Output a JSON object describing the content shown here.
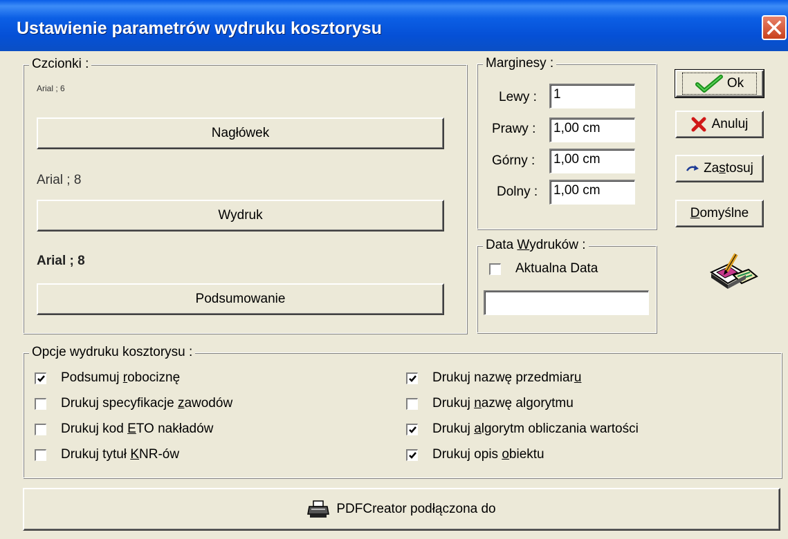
{
  "window": {
    "title": "Ustawienie parametrów wydruku kosztorysu"
  },
  "fonts": {
    "label": "Czcionki :",
    "naglowek_font": "Arial ; 6",
    "naglowek_button": "Nagłówek",
    "wydruk_font": "Arial ; 8",
    "wydruk_button": "Wydruk",
    "podsumowanie_font": "Arial ; 8",
    "podsumowanie_button": "Podsumowanie"
  },
  "margins": {
    "label": "Marginesy :",
    "lewy_label": "Lewy :",
    "lewy_value": "1",
    "prawy_label": "Prawy :",
    "prawy_value": "1,00 cm",
    "gorny_label": "Górny :",
    "gorny_value": "1,00 cm",
    "dolny_label": "Dolny :",
    "dolny_value": "1,00 cm"
  },
  "date": {
    "label_pre": "Data ",
    "label_u": "W",
    "label_post": "ydruków :",
    "current_label": "Aktualna Data",
    "current_checked": false,
    "value": ""
  },
  "actions": {
    "ok": "Ok",
    "cancel": "Anuluj",
    "apply_pre": "Za",
    "apply_u": "s",
    "apply_post": "tosuj",
    "defaults_u": "D",
    "defaults_post": "omyślne"
  },
  "options": {
    "label": "Opcje wydruku kosztorysu :",
    "items": [
      {
        "pre": "Podsumuj ",
        "u": "r",
        "post": "obociznę",
        "checked": true
      },
      {
        "pre": "Drukuj specyfikacje ",
        "u": "z",
        "post": "awodów",
        "checked": false
      },
      {
        "pre": "Drukuj kod ",
        "u": "E",
        "post": "TO nakładów",
        "checked": false
      },
      {
        "pre": "Drukuj tytuł ",
        "u": "K",
        "post": "NR-ów",
        "checked": false
      },
      {
        "pre": "Drukuj nazwę przedmiar",
        "u": "u",
        "post": "",
        "checked": true
      },
      {
        "pre": "Drukuj ",
        "u": "n",
        "post": "azwę algorytmu",
        "checked": false
      },
      {
        "pre": "Drukuj ",
        "u": "a",
        "post": "lgorytm obliczania wartości",
        "checked": true
      },
      {
        "pre": "Drukuj opis ",
        "u": "o",
        "post": "biektu",
        "checked": true
      }
    ]
  },
  "printer": {
    "label": "PDFCreator podłączona do"
  },
  "icons": {
    "close": "close-icon",
    "ok": "checkmark-icon",
    "cancel": "red-x-icon",
    "apply": "redo-arrow-icon",
    "printer_setup": "printer-paper-pencil-icon",
    "printer": "printer-icon"
  }
}
